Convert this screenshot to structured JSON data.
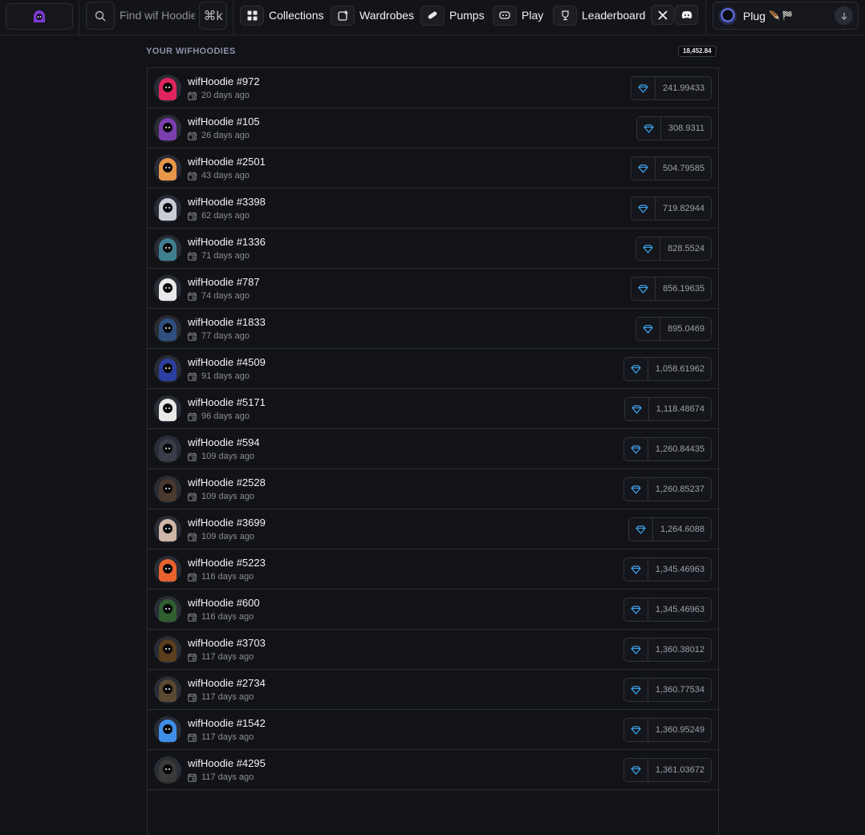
{
  "topbar": {
    "search_placeholder": "Find wif Hoodie...",
    "shortcut": "⌘k",
    "nav": [
      {
        "label": "Collections",
        "icon": "grid-icon"
      },
      {
        "label": "Wardrobes",
        "icon": "plus-box-icon"
      },
      {
        "label": "Pumps",
        "icon": "pill-icon"
      },
      {
        "label": "Play",
        "icon": "gamepad-icon"
      },
      {
        "label": "Leaderboard",
        "icon": "trophy-icon"
      }
    ],
    "social": [
      "x-icon",
      "discord-icon"
    ],
    "wallet": {
      "label": "Plug",
      "extra": "🪶 🏁"
    }
  },
  "section": {
    "title": "YOUR WIFHOODIES",
    "total": "18,452.84"
  },
  "colors": {
    "accent": "#3fa7f5",
    "background": "#121317"
  },
  "items": [
    {
      "name": "wifHoodie #972",
      "age": "20 days ago",
      "value": "241.99433",
      "hood": "#e0245e"
    },
    {
      "name": "wifHoodie #105",
      "age": "26 days ago",
      "value": "308.9311",
      "hood": "#7b3fb0"
    },
    {
      "name": "wifHoodie #2501",
      "age": "43 days ago",
      "value": "504.79585",
      "hood": "#e8964a"
    },
    {
      "name": "wifHoodie #3398",
      "age": "62 days ago",
      "value": "719.82944",
      "hood": "#c9ccd4"
    },
    {
      "name": "wifHoodie #1336",
      "age": "71 days ago",
      "value": "828.5524",
      "hood": "#3f7f8f"
    },
    {
      "name": "wifHoodie #787",
      "age": "74 days ago",
      "value": "856.19635",
      "hood": "#e8e8e8"
    },
    {
      "name": "wifHoodie #1833",
      "age": "77 days ago",
      "value": "895.0469",
      "hood": "#2f4f7f"
    },
    {
      "name": "wifHoodie #4509",
      "age": "91 days ago",
      "value": "1,058.61962",
      "hood": "#2a3f9f"
    },
    {
      "name": "wifHoodie #5171",
      "age": "96 days ago",
      "value": "1,118.48674",
      "hood": "#e8e8e8"
    },
    {
      "name": "wifHoodie #594",
      "age": "109 days ago",
      "value": "1,260.84435",
      "hood": "#3a3d48"
    },
    {
      "name": "wifHoodie #2528",
      "age": "109 days ago",
      "value": "1,260.85237",
      "hood": "#4a3a2e"
    },
    {
      "name": "wifHoodie #3699",
      "age": "109 days ago",
      "value": "1,264.6088",
      "hood": "#d0b6a6"
    },
    {
      "name": "wifHoodie #5223",
      "age": "116 days ago",
      "value": "1,345.46963",
      "hood": "#e8622e"
    },
    {
      "name": "wifHoodie #600",
      "age": "116 days ago",
      "value": "1,345.46963",
      "hood": "#2f5f2f"
    },
    {
      "name": "wifHoodie #3703",
      "age": "117 days ago",
      "value": "1,360.38012",
      "hood": "#5a3e1e"
    },
    {
      "name": "wifHoodie #2734",
      "age": "117 days ago",
      "value": "1,360.77534",
      "hood": "#5a4830"
    },
    {
      "name": "wifHoodie #1542",
      "age": "117 days ago",
      "value": "1,360.95249",
      "hood": "#3f8fe8"
    },
    {
      "name": "wifHoodie #4295",
      "age": "117 days ago",
      "value": "1,361.03672",
      "hood": "#3a3a3a"
    }
  ]
}
